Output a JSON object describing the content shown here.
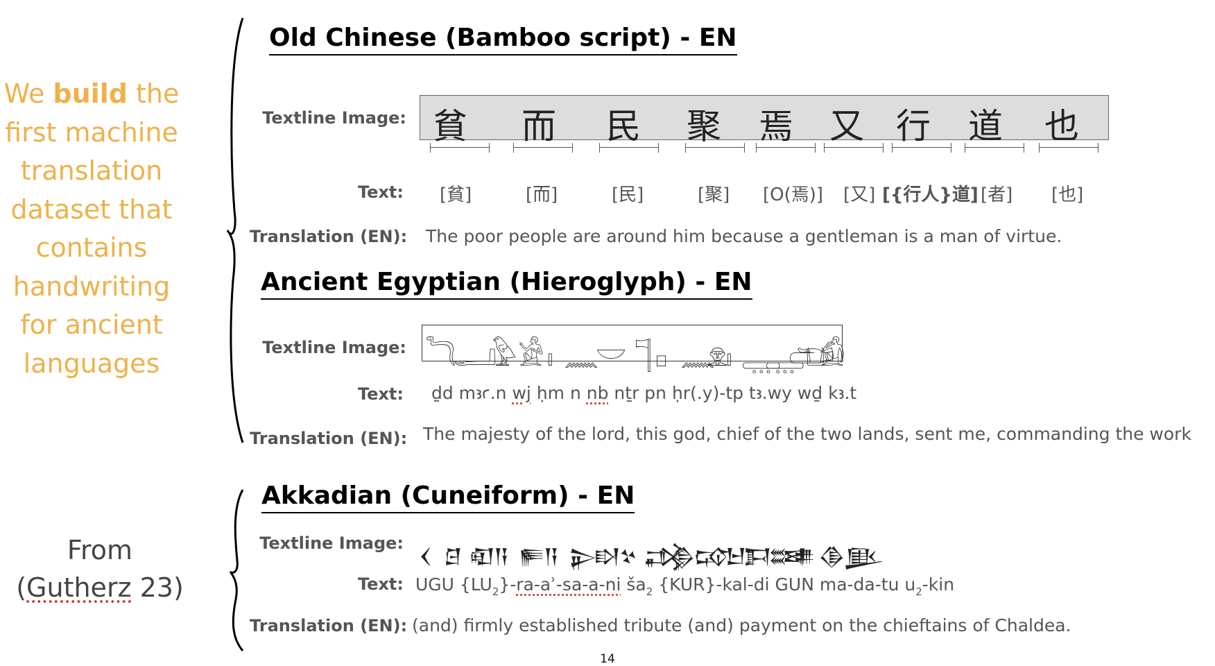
{
  "left_panel": {
    "claim_pre": "We ",
    "claim_bold": "build",
    "claim_post": " the",
    "claim_lines": [
      "first machine",
      "translation",
      "dataset that",
      "contains",
      "handwriting",
      "for ancient",
      "languages"
    ],
    "source_line1": "From",
    "source_paren_open": "(",
    "source_ref": "Gutherz",
    "source_rest": " 23)"
  },
  "colors": {
    "accent": "#EDB24A",
    "label": "#555555",
    "heading": "#000000"
  },
  "sections": {
    "chinese": {
      "title": "Old Chinese (Bamboo script) - EN",
      "image_label": "Textline Image:",
      "text_label": "Text:",
      "translation_label": "Translation (EN):",
      "glyphs": [
        "貧",
        "而",
        "民",
        "聚",
        "焉",
        "又",
        "行",
        "道",
        "也"
      ],
      "tokens": [
        "[貧]",
        "[而]",
        "[民]",
        "[聚]",
        "[O(焉)]",
        "[又]",
        "[{行人}道]",
        "[者]",
        "[也]"
      ],
      "translation": "The poor people are around him because a gentleman is a man of virtue."
    },
    "egyptian": {
      "title": "Ancient Egyptian (Hieroglyph) - EN",
      "image_label": "Textline Image:",
      "text_label": "Text:",
      "translation_label": "Translation (EN):",
      "glyphs": [
        "𓆓",
        "𓂝",
        "𓅱",
        "𓀀",
        "𓏤",
        "𓈖",
        "𓎟",
        "𓊹",
        "𓊪",
        "𓈖",
        "𓁷",
        "𓏤",
        "𓇾",
        "𓇾",
        "𓂧",
        "𓂓",
        "𓀁"
      ],
      "text_parts": [
        "ḏd mꜣꜥ.n ",
        "wj",
        " ḥm n ",
        "nb",
        " nṯr pn ḥr(.y)-tp tꜣ.wy wḏ kꜣ.t"
      ],
      "translation": "The majesty of the lord, this god, chief of the two lands, sent me, commanding the work"
    },
    "akkadian": {
      "title": "Akkadian (Cuneiform) - EN",
      "image_label": "Textline Image:",
      "text_label": "Text:",
      "translation_label": "Translation (EN):",
      "glyphs": [
        "𒌋",
        "𒆪",
        "𒊏",
        "𒀀",
        "𒊓",
        "𒀀",
        "𒉌",
        "𒊭",
        "𒆳",
        "𒃶",
        "𒁲",
        "𒄘",
        "𒈠",
        "𒁕",
        "𒌅",
        "𒌑",
        "𒆠",
        "𒆥"
      ],
      "text_a": "UGU {LU",
      "text_a_sub": "2",
      "text_b": "}-",
      "text_dotted": "ra-aʾ-sa-a-ni",
      "text_c": " ša",
      "text_c_sub": "2",
      "text_d": " {KUR}-kal-di GUN ma-da-tu u",
      "text_d_sub": "2",
      "text_e": "-kin",
      "translation": "(and) firmly established tribute (and) payment on the chieftains of Chaldea."
    }
  },
  "page_number": "14"
}
